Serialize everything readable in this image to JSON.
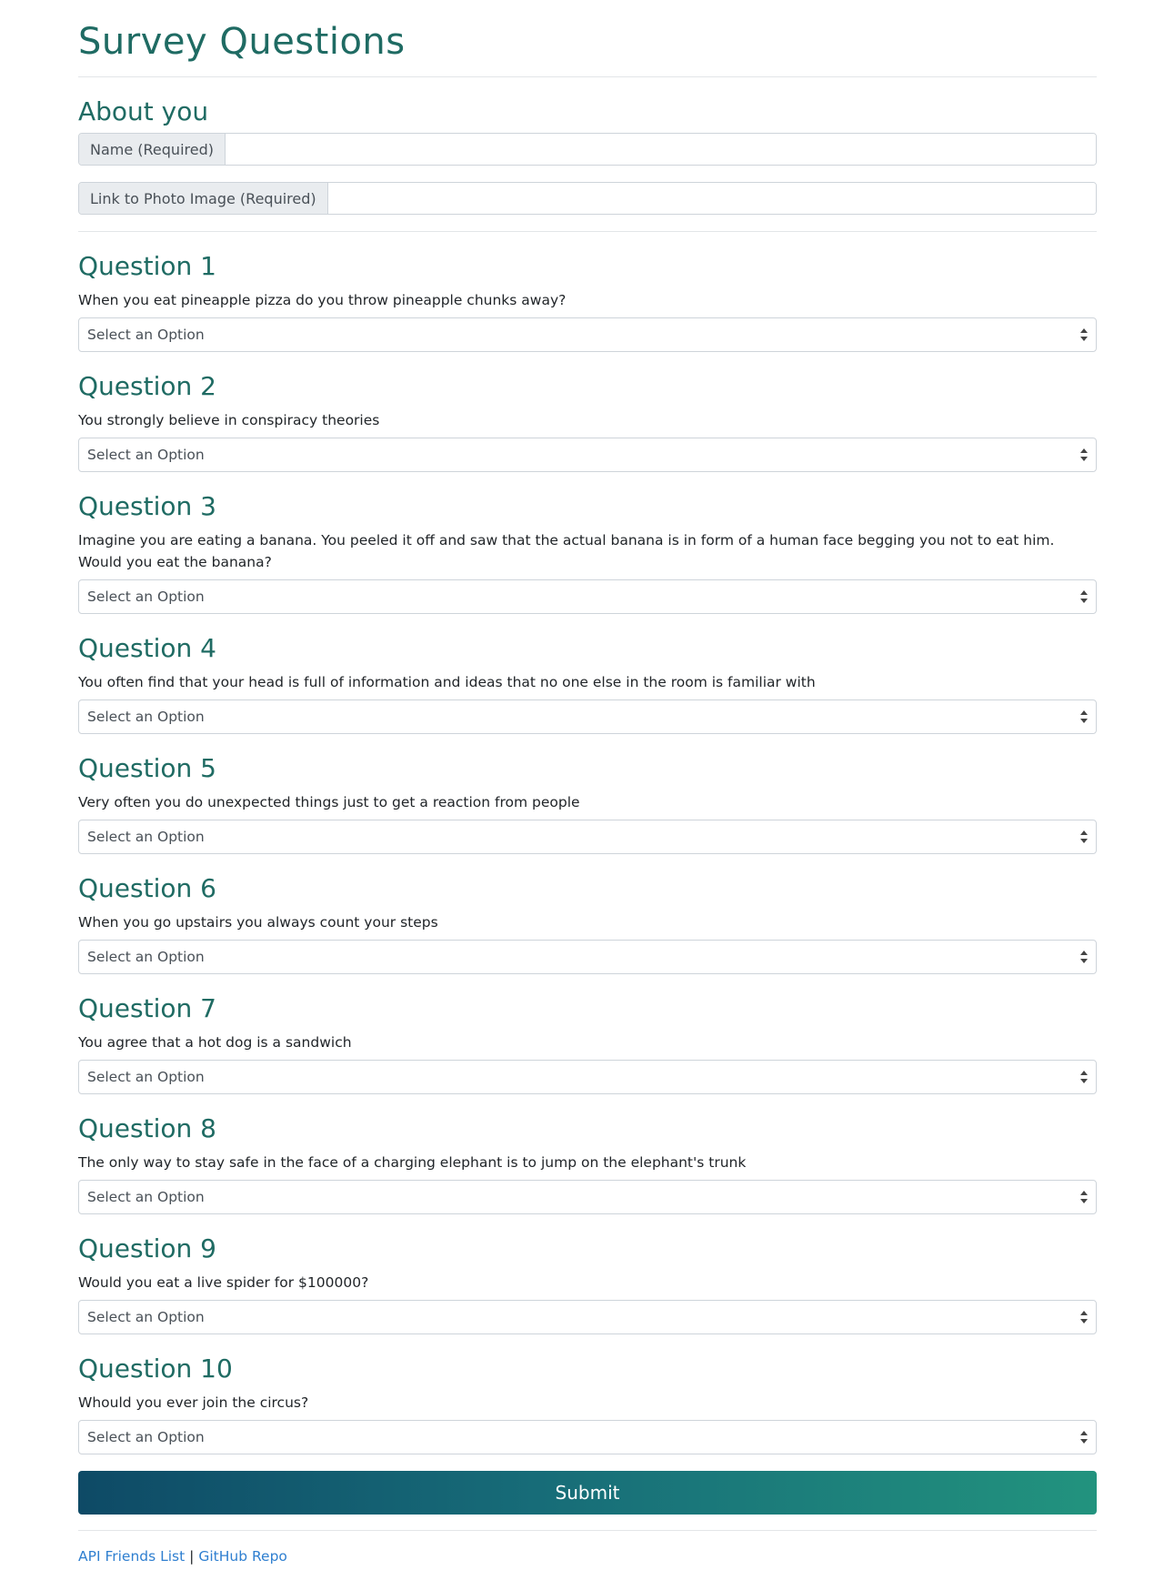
{
  "page": {
    "title": "Survey Questions"
  },
  "about": {
    "heading": "About you",
    "name_label": "Name (Required)",
    "name_value": "",
    "photo_label": "Link to Photo Image (Required)",
    "photo_value": ""
  },
  "select_placeholder": "Select an Option",
  "questions": [
    {
      "heading": "Question 1",
      "text": "When you eat pineapple pizza do you throw pineapple chunks away?",
      "selected": "Select an Option"
    },
    {
      "heading": "Question 2",
      "text": "You strongly believe in conspiracy theories",
      "selected": "Select an Option"
    },
    {
      "heading": "Question 3",
      "text": "Imagine you are eating a banana. You peeled it off and saw that the actual banana is in form of a human face begging you not to eat him. Would you eat the banana?",
      "selected": "Select an Option"
    },
    {
      "heading": "Question 4",
      "text": "You often find that your head is full of information and ideas that no one else in the room is familiar with",
      "selected": "Select an Option"
    },
    {
      "heading": "Question 5",
      "text": "Very often you do unexpected things just to get a reaction from people",
      "selected": "Select an Option"
    },
    {
      "heading": "Question 6",
      "text": "When you go upstairs you always count your steps",
      "selected": "Select an Option"
    },
    {
      "heading": "Question 7",
      "text": "You agree that a hot dog is a sandwich",
      "selected": "Select an Option"
    },
    {
      "heading": "Question 8",
      "text": "The only way to stay safe in the face of a charging elephant is to jump on the elephant's trunk",
      "selected": "Select an Option"
    },
    {
      "heading": "Question 9",
      "text": "Would you eat a live spider for $100000?",
      "selected": "Select an Option"
    },
    {
      "heading": "Question 10",
      "text": "Whould you ever join the circus?",
      "selected": "Select an Option"
    }
  ],
  "submit_label": "Submit",
  "footer": {
    "link1": "API Friends List",
    "separator": "|",
    "link2": "GitHub Repo"
  },
  "colors": {
    "heading": "#1f6b63",
    "link": "#2f7fd0",
    "button_start": "#0e4a66",
    "button_end": "#22937e"
  }
}
